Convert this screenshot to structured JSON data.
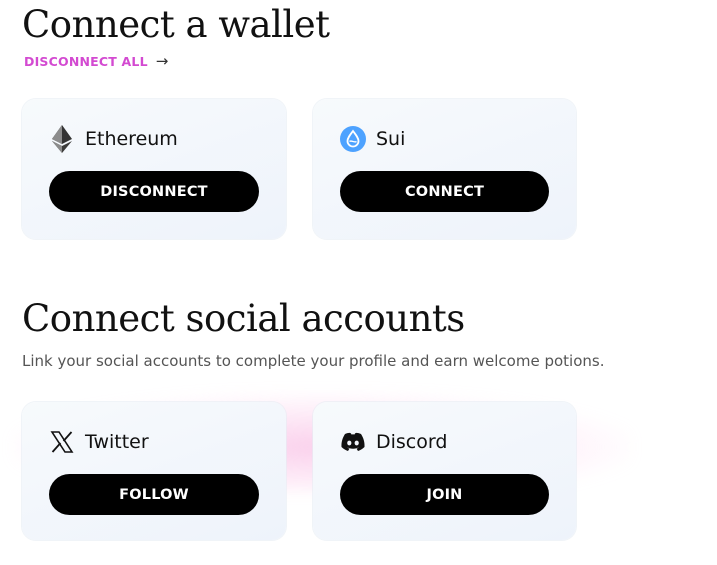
{
  "wallet_section": {
    "title": "Connect a wallet",
    "disconnect_all_label": "DISCONNECT ALL",
    "cards": {
      "ethereum": {
        "name": "Ethereum",
        "button_label": "DISCONNECT",
        "icon": "ethereum-icon"
      },
      "sui": {
        "name": "Sui",
        "button_label": "CONNECT",
        "icon": "sui-icon"
      }
    }
  },
  "social_section": {
    "title": "Connect social accounts",
    "subtitle": "Link your social accounts to complete your profile and earn welcome potions.",
    "cards": {
      "twitter": {
        "name": "Twitter",
        "button_label": "FOLLOW",
        "icon": "x-icon"
      },
      "discord": {
        "name": "Discord",
        "button_label": "JOIN",
        "icon": "discord-icon"
      }
    }
  },
  "colors": {
    "accent": "#d34ad1",
    "button_bg": "#000000",
    "sui_blue": "#4da2ff"
  }
}
